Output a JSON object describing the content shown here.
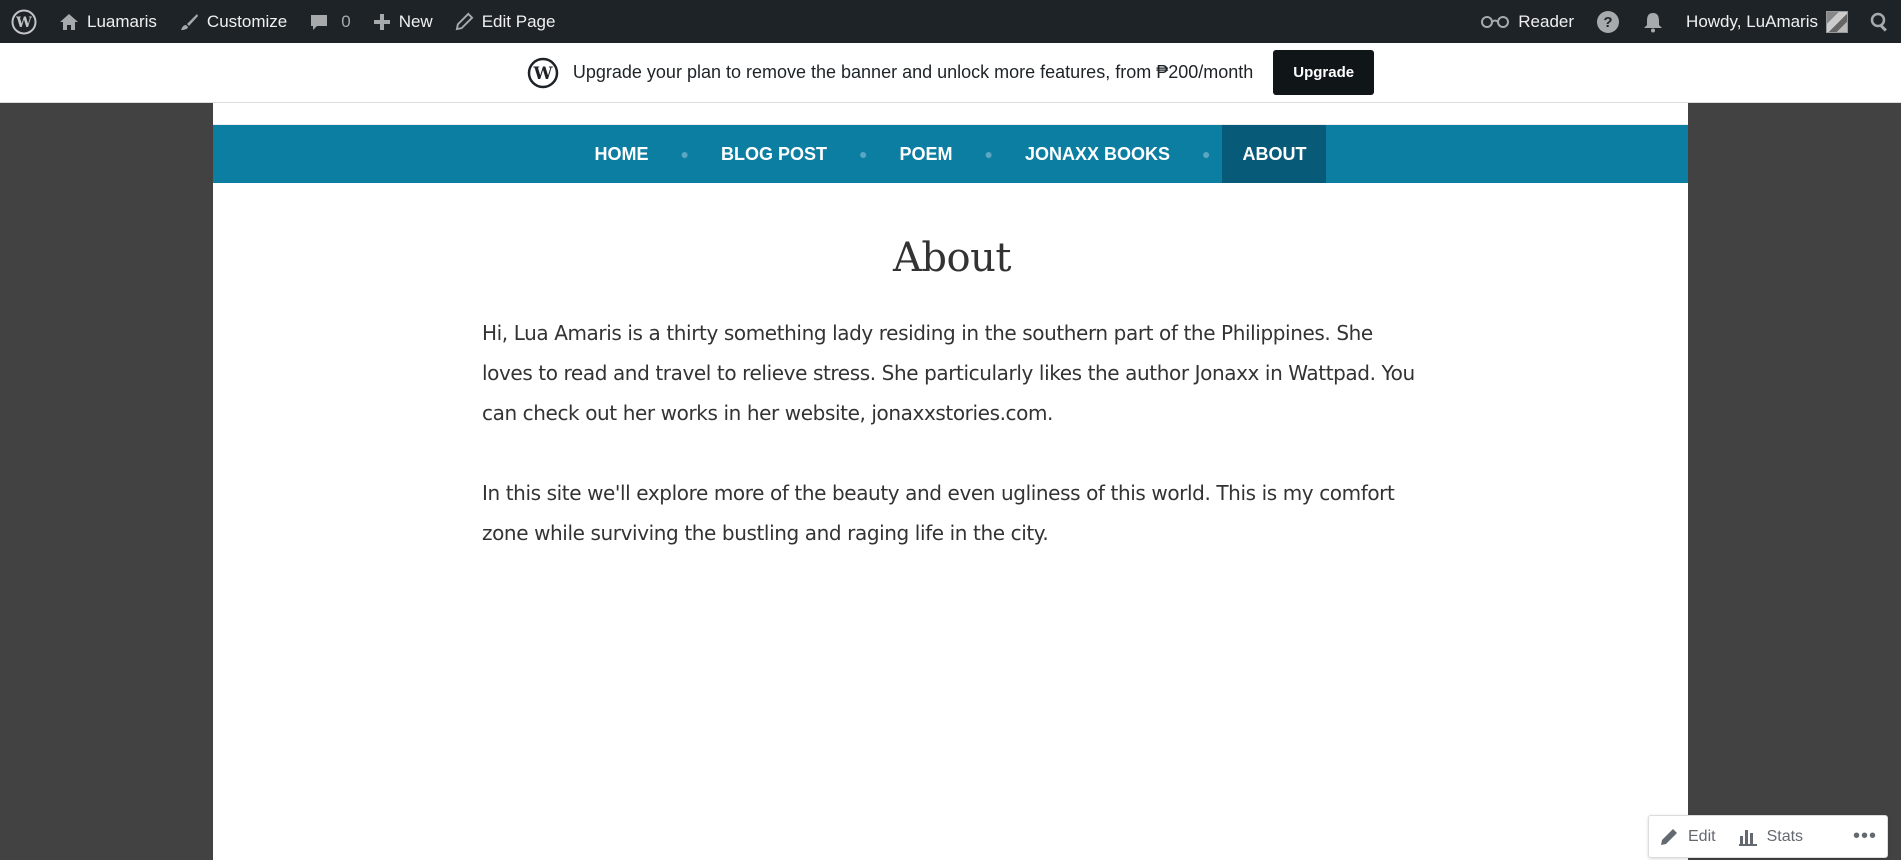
{
  "adminbar": {
    "site_name": "Luamaris",
    "customize": "Customize",
    "comments_count": "0",
    "new": "New",
    "edit_page": "Edit Page",
    "reader": "Reader",
    "greeting": "Howdy, LuAmaris"
  },
  "banner": {
    "text": "Upgrade your plan to remove the banner and unlock more features, from ₱200/month",
    "button": "Upgrade"
  },
  "nav": {
    "items": [
      {
        "label": "HOME"
      },
      {
        "label": "BLOG POST"
      },
      {
        "label": "POEM"
      },
      {
        "label": "JONAXX BOOKS"
      },
      {
        "label": "ABOUT",
        "active": true
      }
    ]
  },
  "page": {
    "title": "About",
    "paragraphs": [
      "Hi, Lua Amaris is a thirty something lady residing in the southern part of the Philippines. She loves to read and travel to relieve stress. She particularly likes the author Jonaxx in Wattpad. You can check out her works in her website, jonaxxstories.com.",
      "In this site we'll explore more of the beauty and even ugliness of this world. This is my comfort zone while surviving the bustling and raging life in the city."
    ]
  },
  "actions": {
    "edit": "Edit",
    "stats": "Stats",
    "more": "•••"
  },
  "colors": {
    "adminbar": "#1d2327",
    "nav": "#0c7ea2",
    "nav_active": "#075a78",
    "backdrop": "#424242"
  }
}
